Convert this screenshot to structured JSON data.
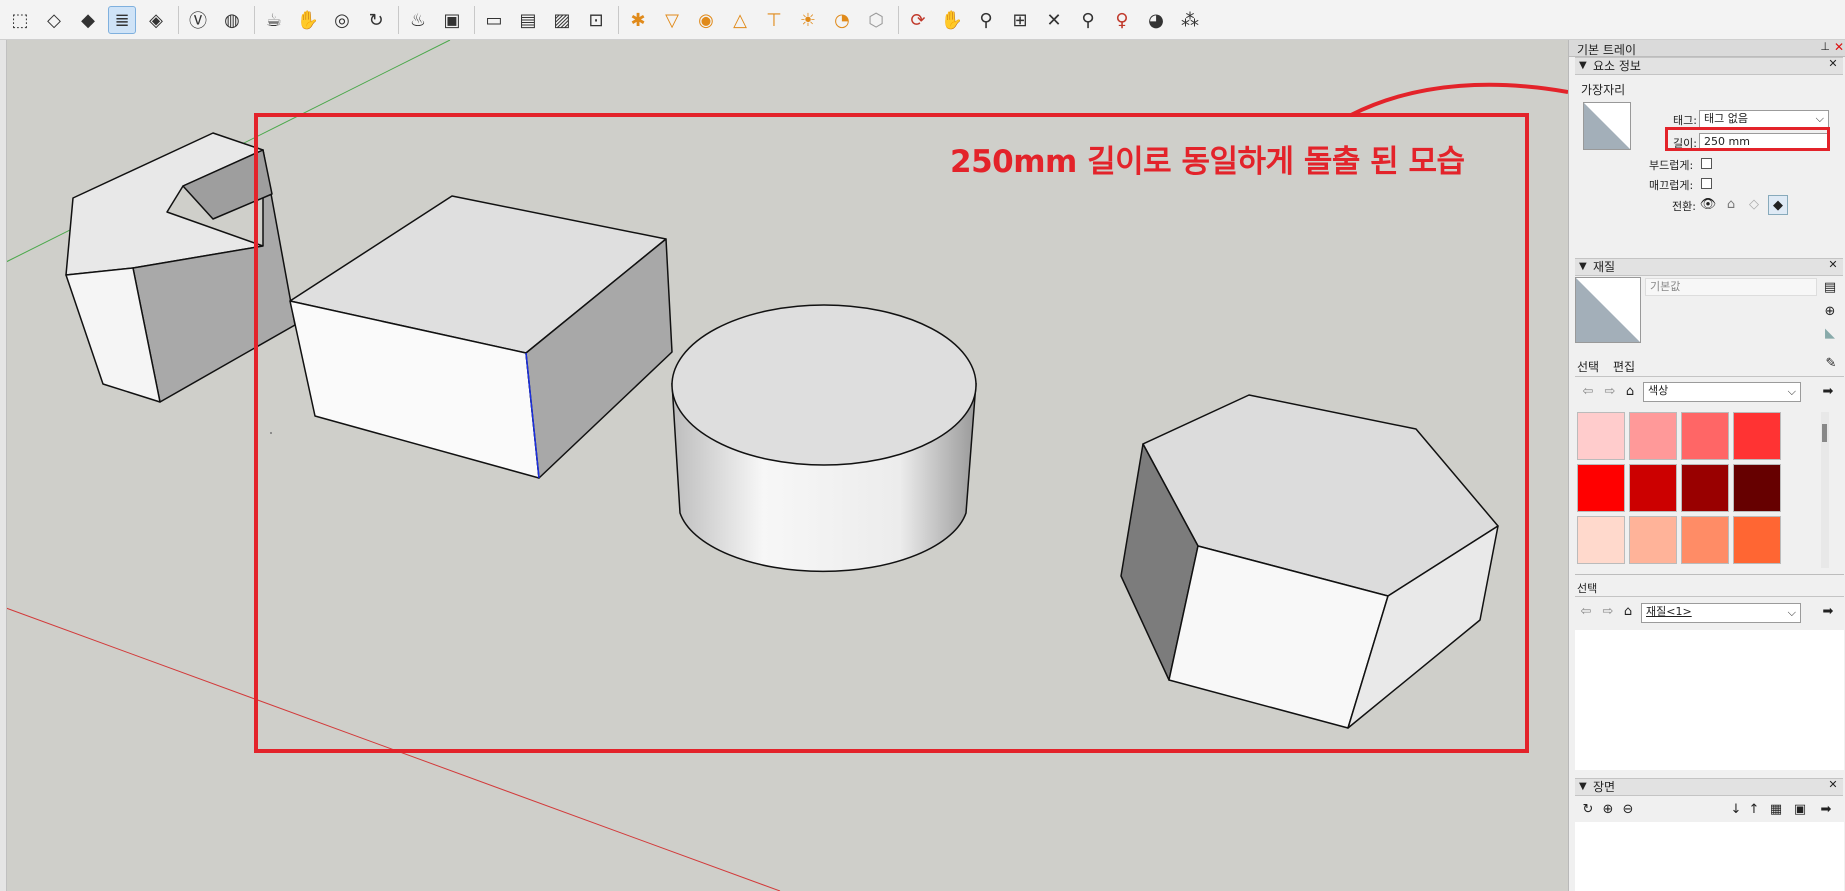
{
  "toolbar": {
    "groups": [
      [
        "select-icon",
        "eraser-icon",
        "paint-bucket-icon",
        "layers-icon",
        "component-icon"
      ],
      [
        "vray-icon",
        "palette-icon"
      ],
      [
        "teapot-icon",
        "hand-render-icon",
        "orbit-render-icon",
        "refresh-icon"
      ],
      [
        "lamp-icon",
        "frame-icon"
      ],
      [
        "window-icon",
        "window-light-icon",
        "window-image-icon",
        "lock-icon"
      ],
      [
        "light-settings-icon",
        "spot-light-icon",
        "sphere-light-icon",
        "cone-light-icon",
        "dome-light-icon",
        "sun-light-icon",
        "ies-light-icon",
        "mesh-light-icon"
      ],
      [
        "orbit-icon",
        "pan-icon",
        "zoom-icon",
        "zoom-window-icon",
        "zoom-extents-icon",
        "zoom-previous-icon",
        "position-camera-icon",
        "look-around-icon",
        "walk-icon"
      ]
    ]
  },
  "annotation": {
    "text": "250mm 길이로 동일하게 돌출 된 모습",
    "color": "#e3232a"
  },
  "tray": {
    "title": "기본 트레이",
    "entity_info": {
      "header": "요소 정보",
      "entity_type": "가장자리",
      "tag_label": "태그:",
      "tag_value": "태그 없음",
      "length_label": "길이:",
      "length_value": "250 mm",
      "soft_label": "부드럽게:",
      "smooth_label": "매끄럽게:",
      "visibility_label": "전환:"
    },
    "materials": {
      "header": "재질",
      "material_name": "기본값",
      "tab_select": "선택",
      "tab_edit": "편집",
      "library": "색상",
      "swatches": [
        "#ffcccc",
        "#ff9999",
        "#ff6666",
        "#ff3333",
        "#ff0000",
        "#cc0000",
        "#990000",
        "#660000",
        "#ffd9cc",
        "#ffb399",
        "#ff8c66",
        "#ff6633"
      ]
    },
    "select_panel": {
      "label": "선택",
      "dropdown": "재질<1>"
    },
    "scenes": {
      "header": "장면"
    }
  }
}
